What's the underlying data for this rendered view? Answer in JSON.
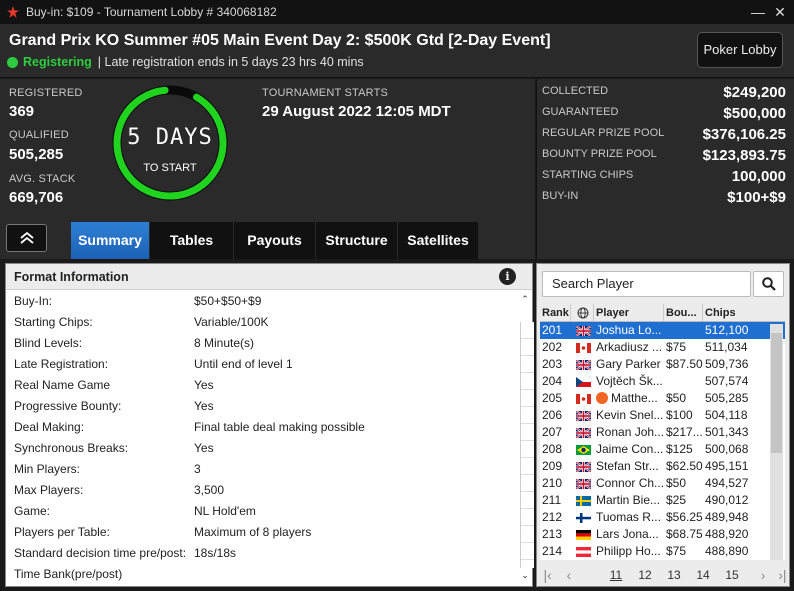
{
  "window": {
    "title": "Buy-in: $109 - Tournament Lobby # 340068182",
    "minimize_label": "―",
    "close_label": "✕"
  },
  "header": {
    "tournament_name": "Grand Prix KO Summer #05 Main Event Day 2: $500K Gtd [2-Day Event]",
    "status": "Registering",
    "late_reg": "| Late registration ends in 5 days 23 hrs  40 mins",
    "lobby_button": "Poker Lobby"
  },
  "stats": {
    "registered_label": "REGISTERED",
    "registered_value": "369",
    "qualified_label": "QUALIFIED",
    "qualified_value": "505,285",
    "avg_stack_label": "AVG. STACK",
    "avg_stack_value": "669,706",
    "countdown_main": "5 DAYS",
    "countdown_sub": "TO START",
    "starts_label": "TOURNAMENT STARTS",
    "starts_value": "29 August 2022  12:05 MDT"
  },
  "prize": {
    "rows": [
      {
        "label": "COLLECTED",
        "value": "$249,200"
      },
      {
        "label": "GUARANTEED",
        "value": "$500,000"
      },
      {
        "label": "REGULAR PRIZE POOL",
        "value": "$376,106.25"
      },
      {
        "label": "BOUNTY PRIZE POOL",
        "value": "$123,893.75"
      },
      {
        "label": "STARTING CHIPS",
        "value": "100,000"
      },
      {
        "label": "BUY-IN",
        "value": "$100+$9"
      }
    ]
  },
  "tabs": [
    {
      "label": "Summary",
      "active": true
    },
    {
      "label": "Tables",
      "active": false
    },
    {
      "label": "Payouts",
      "active": false
    },
    {
      "label": "Structure",
      "active": false
    },
    {
      "label": "Satellites",
      "active": false
    }
  ],
  "format": {
    "title": "Format Information",
    "info_icon": "i",
    "rows": [
      {
        "k": "Buy-In:",
        "v": "$50+$50+$9"
      },
      {
        "k": "Starting Chips:",
        "v": "Variable/100K"
      },
      {
        "k": "Blind Levels:",
        "v": "8 Minute(s)"
      },
      {
        "k": "Late Registration:",
        "v": "Until end of level 1"
      },
      {
        "k": "Real Name Game",
        "v": "Yes"
      },
      {
        "k": "Progressive Bounty:",
        "v": "Yes"
      },
      {
        "k": "Deal Making:",
        "v": "Final table deal making possible"
      },
      {
        "k": "Synchronous Breaks:",
        "v": "Yes"
      },
      {
        "k": "Min Players:",
        "v": "3"
      },
      {
        "k": "Max Players:",
        "v": "3,500"
      },
      {
        "k": "Game:",
        "v": "NL Hold'em"
      },
      {
        "k": "Players per Table:",
        "v": "Maximum of 8 players"
      },
      {
        "k": "Standard decision time pre/post:",
        "v": "18s/18s"
      },
      {
        "k": "Time Bank(pre/post)",
        "v": ""
      }
    ]
  },
  "players": {
    "search_placeholder": "Search Player",
    "headers": {
      "rank": "Rank",
      "player": "Player",
      "bounty": "Bou...",
      "chips": "Chips"
    },
    "rows": [
      {
        "rank": "201",
        "flag": "gb",
        "player": "Joshua Lo...",
        "bounty": "",
        "chips": "512,100",
        "selected": true
      },
      {
        "rank": "202",
        "flag": "ca",
        "player": "Arkadiusz ...",
        "bounty": "$75",
        "chips": "511,034"
      },
      {
        "rank": "203",
        "flag": "gb",
        "player": "Gary Parker",
        "bounty": "$87.50",
        "chips": "509,736"
      },
      {
        "rank": "204",
        "flag": "cz",
        "player": "Vojtěch Šk...",
        "bounty": "",
        "chips": "507,574"
      },
      {
        "rank": "205",
        "flag": "ca",
        "player": "Matthe...",
        "bounty": "$50",
        "chips": "505,285",
        "pro": true
      },
      {
        "rank": "206",
        "flag": "gb",
        "player": "Kevin Snel...",
        "bounty": "$100",
        "chips": "504,118"
      },
      {
        "rank": "207",
        "flag": "gb",
        "player": "Ronan Joh...",
        "bounty": "$217...",
        "chips": "501,343"
      },
      {
        "rank": "208",
        "flag": "br",
        "player": "Jaime Con...",
        "bounty": "$125",
        "chips": "500,068"
      },
      {
        "rank": "209",
        "flag": "gb",
        "player": "Stefan Str...",
        "bounty": "$62.50",
        "chips": "495,151"
      },
      {
        "rank": "210",
        "flag": "gb",
        "player": "Connor Ch...",
        "bounty": "$50",
        "chips": "494,527"
      },
      {
        "rank": "211",
        "flag": "se",
        "player": "Martin Bie...",
        "bounty": "$25",
        "chips": "490,012"
      },
      {
        "rank": "212",
        "flag": "fi",
        "player": "Tuomas R...",
        "bounty": "$56.25",
        "chips": "489,948"
      },
      {
        "rank": "213",
        "flag": "de",
        "player": "Lars Jona...",
        "bounty": "$68.75",
        "chips": "488,920"
      },
      {
        "rank": "214",
        "flag": "at",
        "player": "Philipp Ho...",
        "bounty": "$75",
        "chips": "488,890"
      }
    ],
    "pages": [
      "11",
      "12",
      "13",
      "14",
      "15"
    ],
    "current_page": "11"
  }
}
